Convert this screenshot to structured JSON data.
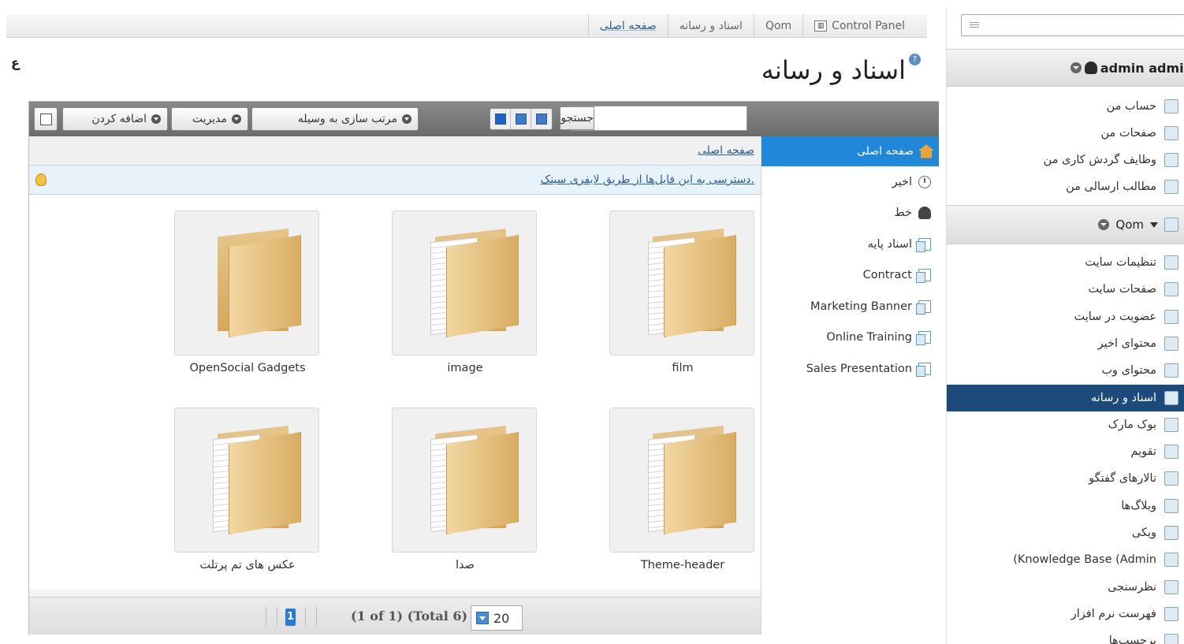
{
  "breadcrumb": {
    "items": [
      "Control Panel",
      "Qom",
      "اسناد و رسانه",
      "صفحه اصلی"
    ]
  },
  "page": {
    "title": "اسناد و رسانه",
    "corner_glyph": "ع"
  },
  "toolbar": {
    "add_label": "اضافه کردن",
    "manage_label": "مدیریت",
    "sort_label": "مرتب سازی به وسیله",
    "search_button": "جستجو",
    "search_value": ""
  },
  "library_nav": {
    "home": "صفحه اصلی",
    "items": [
      {
        "label": "اخیر",
        "icon": "clock-icon"
      },
      {
        "label": "خط",
        "icon": "user-icon"
      },
      {
        "label": "اسناد پایه",
        "icon": "document-type-icon"
      },
      {
        "label": "Contract",
        "icon": "document-type-icon"
      },
      {
        "label": "Marketing Banner",
        "icon": "document-type-icon"
      },
      {
        "label": "Online Training",
        "icon": "document-type-icon"
      },
      {
        "label": "Sales Presentation",
        "icon": "document-type-icon"
      }
    ]
  },
  "content": {
    "crumb": "صفحه اصلی",
    "info_link": "دسترسی به این فایل‌ها از طریق لایفری سینک."
  },
  "folders": [
    {
      "name": "film",
      "paper": true
    },
    {
      "name": "image",
      "paper": true
    },
    {
      "name": "OpenSocial Gadgets",
      "paper": false
    },
    {
      "name": "Theme-header",
      "paper": true
    },
    {
      "name": "صدا",
      "paper": true
    },
    {
      "name": "عکس های تم پرتلت",
      "paper": true
    }
  ],
  "pager": {
    "current_page": "1",
    "summary": "(1 of 1) (Total 6)",
    "per_page": "20"
  },
  "control_panel": {
    "user": "admin admin",
    "my_items": [
      {
        "label": "حساب من",
        "icon": "account-icon"
      },
      {
        "label": "صفحات من",
        "icon": "pages-icon"
      },
      {
        "label": "وظایف گردش کاری من",
        "icon": "workflow-icon"
      },
      {
        "label": "مطالب ارسالی من",
        "icon": "submissions-icon"
      }
    ],
    "site": "Qom",
    "site_items": [
      {
        "label": "تنظیمات سایت",
        "icon": "gear-icon",
        "selected": false
      },
      {
        "label": "صفحات سایت",
        "icon": "site-pages-icon",
        "selected": false
      },
      {
        "label": "عضویت در سایت",
        "icon": "membership-icon",
        "selected": false
      },
      {
        "label": "محتوای اخیر",
        "icon": "recent-content-icon",
        "selected": false
      },
      {
        "label": "محتوای وب",
        "icon": "web-content-icon",
        "selected": false
      },
      {
        "label": "اسناد و رسانه",
        "icon": "documents-media-icon",
        "selected": true
      },
      {
        "label": "بوک مارک",
        "icon": "bookmark-icon",
        "selected": false
      },
      {
        "label": "تقویم",
        "icon": "calendar-icon",
        "selected": false
      },
      {
        "label": "تالارهای گفتگو",
        "icon": "message-boards-icon",
        "selected": false
      },
      {
        "label": "وبلاگ‌ها",
        "icon": "blogs-icon",
        "selected": false
      },
      {
        "label": "ویکی",
        "icon": "wiki-icon",
        "selected": false
      },
      {
        "label": "(Knowledge Base (Admin",
        "icon": "knowledge-base-icon",
        "selected": false
      },
      {
        "label": "نظرسنجی",
        "icon": "polls-icon",
        "selected": false
      },
      {
        "label": "فهرست نرم افزار",
        "icon": "software-catalog-icon",
        "selected": false
      },
      {
        "label": "برچسب‌ها",
        "icon": "tags-icon",
        "selected": false
      }
    ],
    "accent": "#1c4a7a"
  }
}
